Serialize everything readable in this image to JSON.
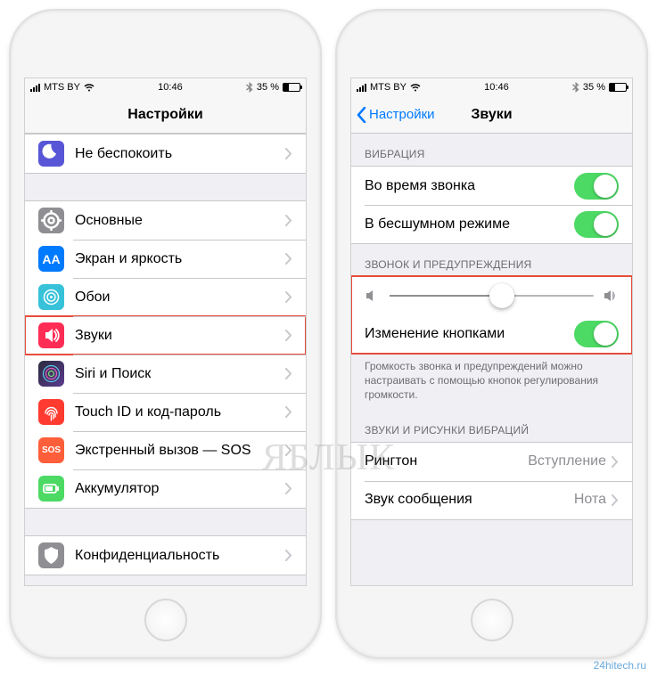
{
  "status": {
    "carrier": "MTS BY",
    "time": "10:46",
    "battery_pct": "35 %"
  },
  "left": {
    "title": "Настройки",
    "groups": [
      {
        "items": [
          {
            "key": "dnd",
            "label": "Не беспокоить",
            "iconClass": "ic-dnd"
          }
        ]
      },
      {
        "items": [
          {
            "key": "general",
            "label": "Основные",
            "iconClass": "ic-general"
          },
          {
            "key": "display",
            "label": "Экран и яркость",
            "iconClass": "ic-display"
          },
          {
            "key": "wallpaper",
            "label": "Обои",
            "iconClass": "ic-wallpaper"
          },
          {
            "key": "sounds",
            "label": "Звуки",
            "iconClass": "ic-sounds",
            "highlight": true
          },
          {
            "key": "siri",
            "label": "Siri и Поиск",
            "iconClass": "ic-siri"
          },
          {
            "key": "touchid",
            "label": "Touch ID и код-пароль",
            "iconClass": "ic-touchid"
          },
          {
            "key": "sos",
            "label": "Экстренный вызов — SOS",
            "iconClass": "ic-sos",
            "text": "SOS"
          },
          {
            "key": "battery",
            "label": "Аккумулятор",
            "iconClass": "ic-battery"
          }
        ]
      },
      {
        "items": [
          {
            "key": "privacy",
            "label": "Конфиденциальность",
            "iconClass": "ic-privacy"
          }
        ]
      }
    ]
  },
  "right": {
    "back": "Настройки",
    "title": "Звуки",
    "sections": {
      "vibration": {
        "header": "ВИБРАЦИЯ",
        "ring": "Во время звонка",
        "silent": "В бесшумном режиме"
      },
      "ringer": {
        "header": "ЗВОНОК И ПРЕДУПРЕЖДЕНИЯ",
        "change_with_buttons": "Изменение кнопками",
        "slider_value": 55,
        "footer": "Громкость звонка и предупреждений можно настраивать с помощью кнопок регулирования громкости."
      },
      "sounds_patterns": {
        "header": "ЗВУКИ И РИСУНКИ ВИБРАЦИЙ",
        "ringtone_label": "Рингтон",
        "ringtone_value": "Вступление",
        "text_label": "Звук сообщения",
        "text_value": "Нота"
      }
    }
  },
  "watermark": "ЯБЛЫК",
  "source": "24hitech.ru"
}
